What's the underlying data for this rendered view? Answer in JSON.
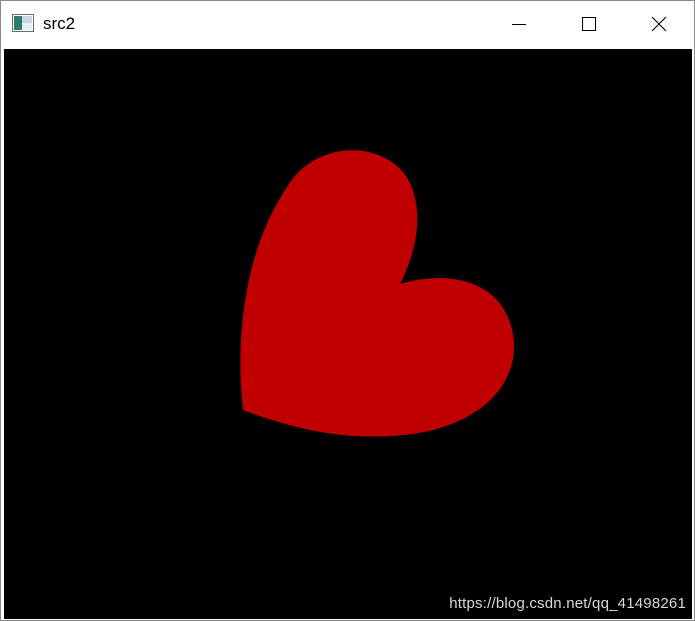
{
  "window": {
    "title": "src2"
  },
  "icons": {
    "app": "app-window-icon",
    "minimize": "minimize-icon",
    "maximize": "maximize-icon",
    "close": "close-icon"
  },
  "canvas": {
    "background": "#000000",
    "shape": "heart",
    "shape_color": "#c00000"
  },
  "watermark": {
    "text": "https://blog.csdn.net/qq_41498261"
  }
}
